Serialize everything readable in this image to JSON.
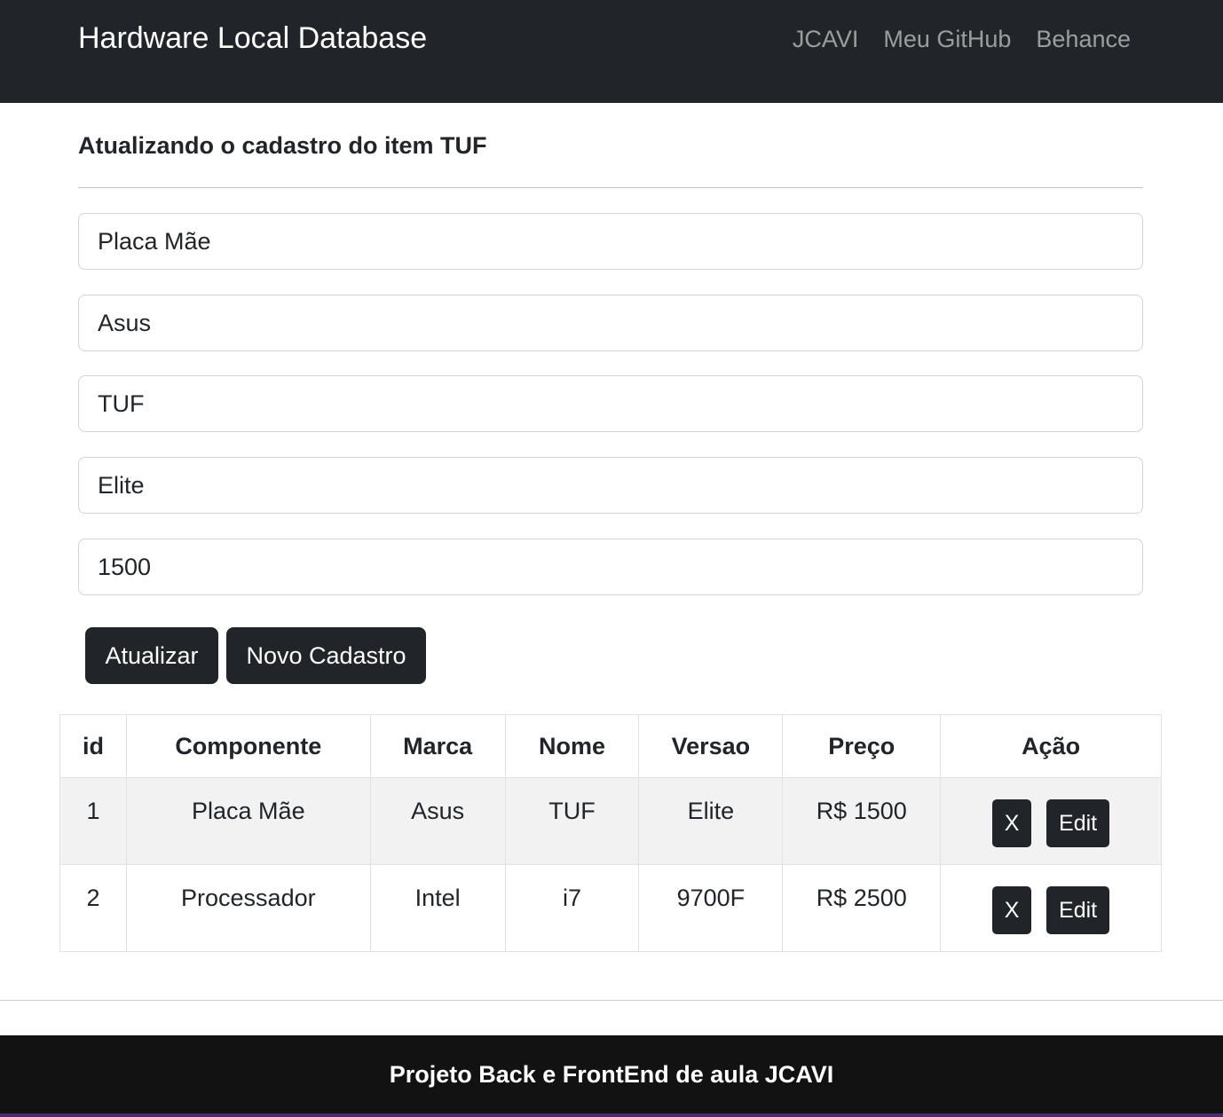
{
  "navbar": {
    "brand": "Hardware Local Database",
    "links": [
      "JCAVI",
      "Meu GitHub",
      "Behance"
    ]
  },
  "form": {
    "heading": "Atualizando o cadastro do item TUF",
    "fields": {
      "componente": "Placa Mãe",
      "marca": "Asus",
      "nome": "TUF",
      "versao": "Elite",
      "preco": "1500"
    },
    "update_label": "Atualizar",
    "new_label": "Novo Cadastro"
  },
  "table": {
    "headers": [
      "id",
      "Componente",
      "Marca",
      "Nome",
      "Versao",
      "Preço",
      "Ação"
    ],
    "rows": [
      [
        "1",
        "Placa Mãe",
        "Asus",
        "TUF",
        "Elite",
        "R$ 1500"
      ],
      [
        "2",
        "Processador",
        "Intel",
        "i7",
        "9700F",
        "R$ 2500"
      ]
    ],
    "delete_label": "X",
    "edit_label": "Edit"
  },
  "footer": {
    "text": "Projeto Back e FrontEnd de aula JCAVI"
  }
}
